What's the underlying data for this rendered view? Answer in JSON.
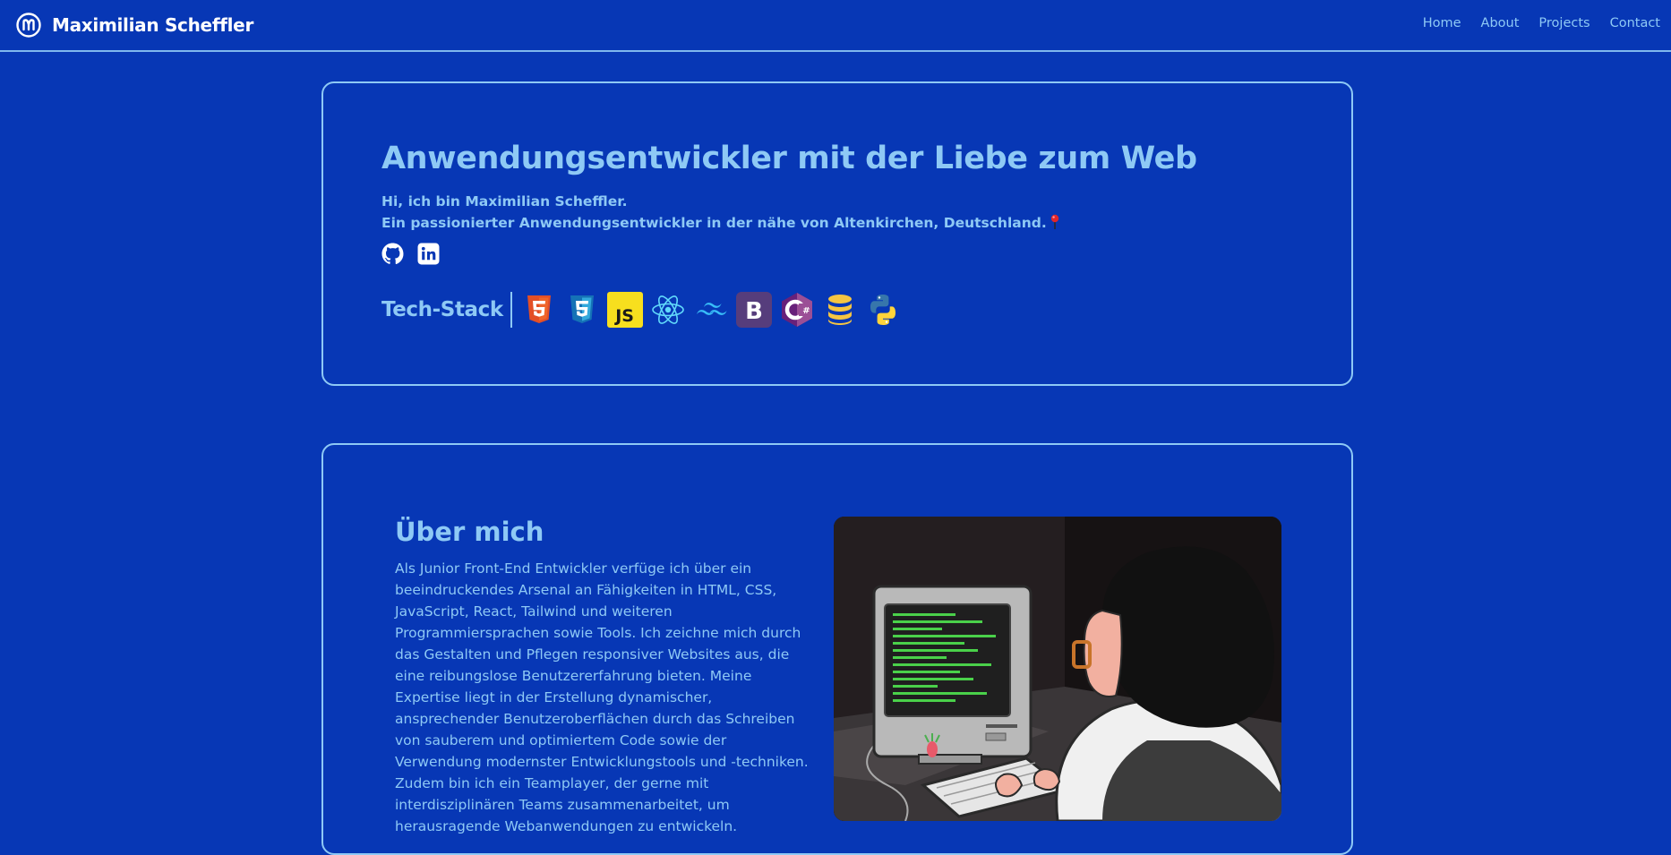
{
  "navbar": {
    "brand_name": "Maximilian Scheffler",
    "links": [
      "Home",
      "About",
      "Projects",
      "Contact"
    ]
  },
  "hero": {
    "title": "Anwendungsentwickler mit der Liebe zum Web",
    "line1": "Hi, ich bin Maximilian Scheffler.",
    "line2": "Ein passionierter Anwendungsentwickler in der nähe von Altenkirchen, Deutschland.",
    "socials": [
      "github-icon",
      "linkedin-icon"
    ],
    "tech_label": "Tech-Stack",
    "tech_icons": [
      "html5-icon",
      "css3-icon",
      "javascript-icon",
      "react-icon",
      "tailwind-icon",
      "bootstrap-icon",
      "csharp-icon",
      "database-icon",
      "python-icon"
    ]
  },
  "about": {
    "title": "Über mich",
    "text": "Als Junior Front-End Entwickler verfüge ich über ein beeindruckendes Arsenal an Fähigkeiten in HTML, CSS, JavaScript, React, Tailwind und weiteren Programmiersprachen sowie Tools. Ich zeichne mich durch das Gestalten und Pflegen responsiver Websites aus, die eine reibungslose Benutzererfahrung bieten. Meine Expertise liegt in der Erstellung dynamischer, ansprechender Benutzeroberflächen durch das Schreiben von sauberem und optimiertem Code sowie der Verwendung modernster Entwicklungstools und -techniken. Zudem bin ich ein Teamplayer, der gerne mit interdisziplinären Teams zusammenarbeitet, um herausragende Webanwendungen zu entwickeln."
  },
  "colors": {
    "background": "#0737b5",
    "accent": "#8ec9f5",
    "white": "#ffffff"
  }
}
